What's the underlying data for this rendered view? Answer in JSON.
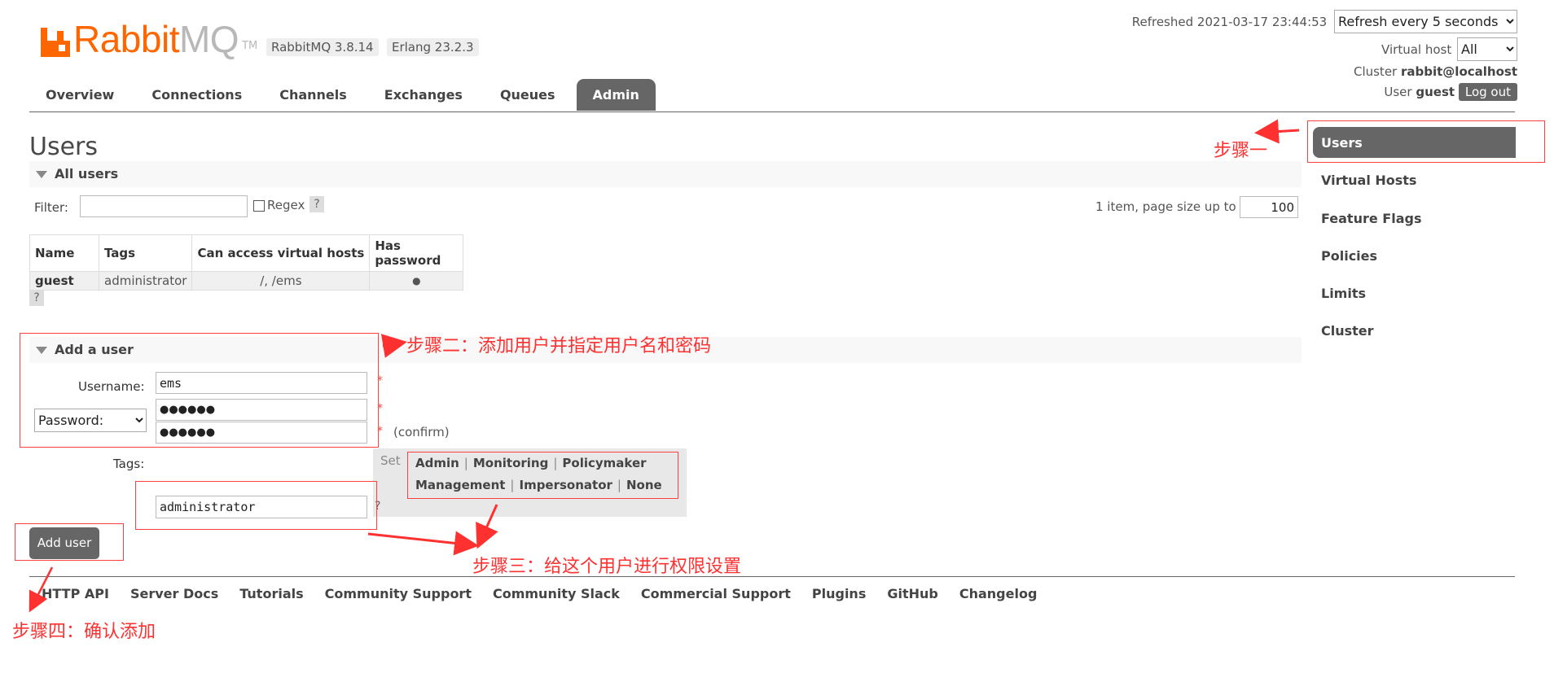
{
  "brand": {
    "name_rabbit": "Rabbit",
    "name_mq": "MQ",
    "tm": "TM"
  },
  "badges": {
    "rabbitmq_version": "RabbitMQ 3.8.14",
    "erlang_version": "Erlang 23.2.3"
  },
  "header": {
    "refreshed_label": "Refreshed 2021-03-17 23:44:53",
    "refresh_select": "Refresh every 5 seconds",
    "vhost_label": "Virtual host",
    "vhost_select": "All",
    "cluster_label": "Cluster",
    "cluster_name": "rabbit@localhost",
    "user_label": "User",
    "user_name": "guest",
    "logout": "Log out"
  },
  "tabs": [
    "Overview",
    "Connections",
    "Channels",
    "Exchanges",
    "Queues",
    "Admin"
  ],
  "sidebar": [
    "Users",
    "Virtual Hosts",
    "Feature Flags",
    "Policies",
    "Limits",
    "Cluster"
  ],
  "page_title": "Users",
  "all_users": {
    "section_title": "All users",
    "filter_label": "Filter:",
    "regex_label": "Regex",
    "help": "?",
    "page_info": "1 item, page size up to",
    "page_size": "100",
    "columns": [
      "Name",
      "Tags",
      "Can access virtual hosts",
      "Has password"
    ],
    "rows": [
      {
        "name": "guest",
        "tags": "administrator",
        "vhosts": "/, /ems",
        "has_password": "●"
      }
    ]
  },
  "add_user": {
    "section_title": "Add a user",
    "username_label": "Username:",
    "username_value": "ems",
    "password_mode": "Password:",
    "password_value": "●●●●●●",
    "password_confirm_value": "●●●●●●",
    "required_mark": "*",
    "confirm_label": "(confirm)",
    "tags_label": "Tags:",
    "set_label": "Set",
    "tag_options_row1": [
      "Admin",
      "Monitoring",
      "Policymaker"
    ],
    "tag_options_row2": [
      "Management",
      "Impersonator",
      "None"
    ],
    "separator": "|",
    "tags_value": "administrator",
    "help": "?",
    "submit": "Add user"
  },
  "footer": [
    "HTTP API",
    "Server Docs",
    "Tutorials",
    "Community Support",
    "Community Slack",
    "Commercial Support",
    "Plugins",
    "GitHub",
    "Changelog"
  ],
  "annotations": {
    "step1": "步骤一",
    "step2": "步骤二：添加用户并指定用户名和密码",
    "step3": "步骤三：给这个用户进行权限设置",
    "step4": "步骤四：确认添加",
    "color": "#ff3030"
  }
}
